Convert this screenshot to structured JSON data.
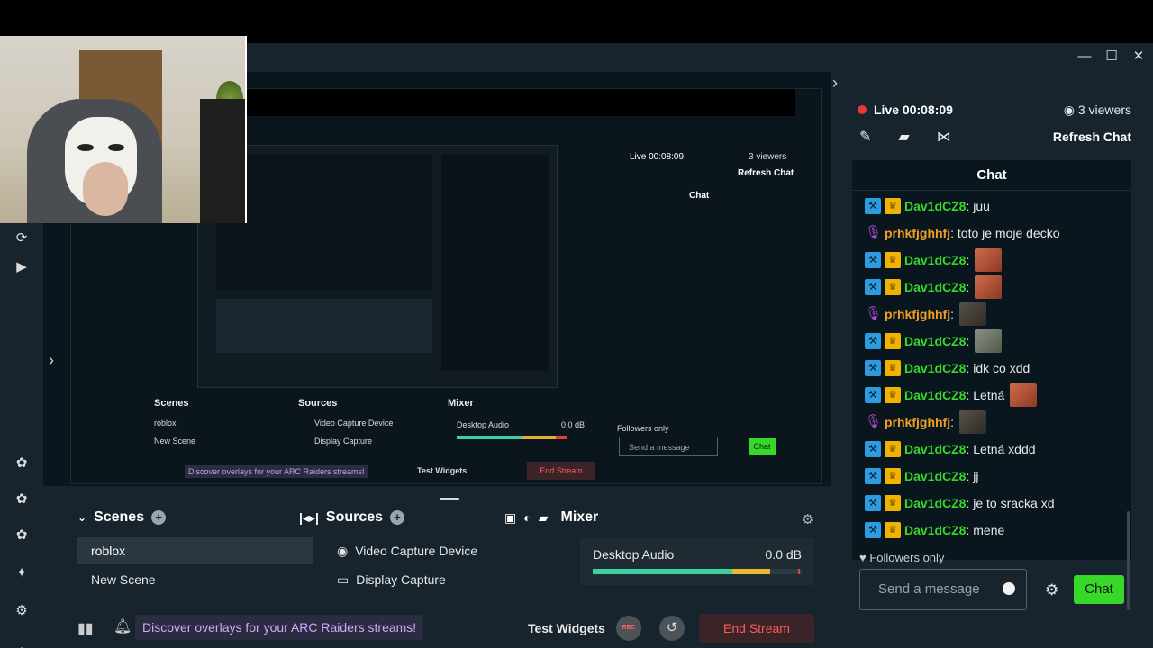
{
  "window": {
    "controls": [
      "—",
      "☐",
      "✕"
    ]
  },
  "preview": {
    "nested": {
      "scenes_title": "Scenes",
      "sources_title": "Sources",
      "mixer_title": "Mixer",
      "scene_active": "roblox",
      "scene_2": "New Scene",
      "source_1": "Video Capture Device",
      "source_2": "Display Capture",
      "mixer_label": "Desktop Audio",
      "mixer_db": "0.0 dB",
      "promo": "Discover overlays for your ARC Raiders streams!",
      "test_widgets": "Test Widgets",
      "end_stream": "End Stream",
      "live": "Live 00:08:09",
      "viewers": "3 viewers",
      "refresh": "Refresh Chat",
      "chat_title": "Chat",
      "followers": "Followers only",
      "placeholder": "Send a message",
      "chat_btn": "Chat"
    }
  },
  "dock": {
    "scenes": {
      "title": "Scenes",
      "items": [
        "roblox",
        "New Scene"
      ]
    },
    "sources": {
      "title": "Sources",
      "items": [
        "Video Capture Device",
        "Display Capture"
      ]
    },
    "mixer": {
      "title": "Mixer",
      "label": "Desktop Audio",
      "db": "0.0 dB",
      "level_green": 0.67,
      "level_yellow": 0.18
    }
  },
  "footer": {
    "promo": "Discover overlays for your ARC Raiders streams!",
    "test_widgets": "Test Widgets",
    "rec_label": "REC",
    "end_stream": "End Stream"
  },
  "chat": {
    "live": "Live 00:08:09",
    "viewers": "3 viewers",
    "refresh": "Refresh Chat",
    "title": "Chat",
    "messages": [
      {
        "user": "Dav1dCZ8",
        "text": ": juu",
        "role": "mod"
      },
      {
        "user": "prhkfjghhfj",
        "text": ": toto je moje decko",
        "role": "mic"
      },
      {
        "user": "Dav1dCZ8",
        "text": ":",
        "role": "mod",
        "emote": "e1"
      },
      {
        "user": "Dav1dCZ8",
        "text": ":",
        "role": "mod",
        "emote": "e1"
      },
      {
        "user": "prhkfjghhfj",
        "text": ":",
        "role": "mic",
        "emote": "e2"
      },
      {
        "user": "Dav1dCZ8",
        "text": ":",
        "role": "mod",
        "emote": "e3"
      },
      {
        "user": "Dav1dCZ8",
        "text": ": idk co xdd",
        "role": "mod"
      },
      {
        "user": "Dav1dCZ8",
        "text": ": Letná",
        "role": "mod",
        "emote": "e1"
      },
      {
        "user": "prhkfjghhfj",
        "text": ":",
        "role": "mic",
        "emote": "e2"
      },
      {
        "user": "Dav1dCZ8",
        "text": ": Letná xddd",
        "role": "mod"
      },
      {
        "user": "Dav1dCZ8",
        "text": ": jj",
        "role": "mod"
      },
      {
        "user": "Dav1dCZ8",
        "text": ": je to sracka xd",
        "role": "mod"
      },
      {
        "user": "Dav1dCZ8",
        "text": ": mene",
        "role": "mod"
      }
    ],
    "followers": "Followers only",
    "placeholder": "Send a message",
    "send_label": "Chat"
  },
  "colors": {
    "accent_green": "#37d82a",
    "live_red": "#e53935",
    "end_red": "#ff5a5a",
    "promo_purple": "#d4a6ff"
  }
}
